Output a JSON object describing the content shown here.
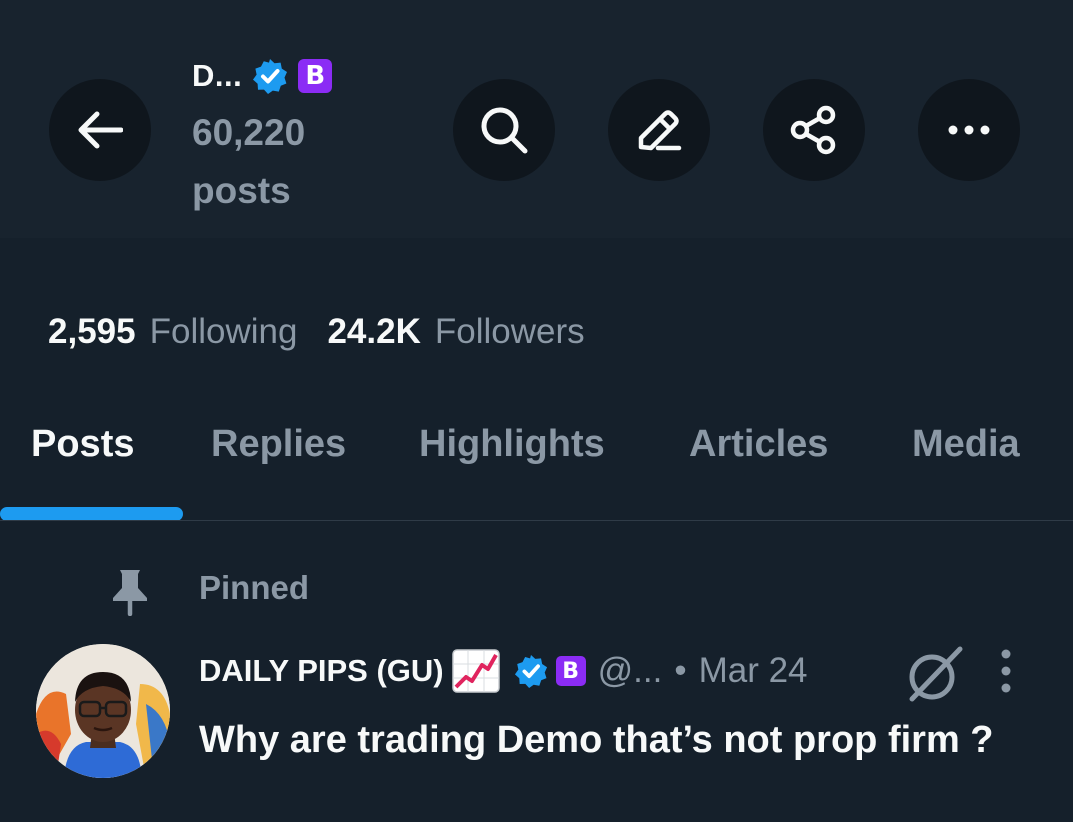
{
  "header": {
    "name": "D...",
    "badge_letter": "B",
    "post_count": "60,220 posts"
  },
  "stats": {
    "following_count": "2,595",
    "following_label": "Following",
    "followers_count": "24.2K",
    "followers_label": "Followers"
  },
  "tabs": [
    {
      "label": "Posts",
      "active": true
    },
    {
      "label": "Replies",
      "active": false
    },
    {
      "label": "Highlights",
      "active": false
    },
    {
      "label": "Articles",
      "active": false
    },
    {
      "label": "Media",
      "active": false
    }
  ],
  "pinned": {
    "label": "Pinned"
  },
  "post": {
    "author_name": "DAILY PIPS (GU)",
    "author_emoji": "📈",
    "badge_letter": "B",
    "handle": "@...",
    "separator": "•",
    "date": "Mar 24",
    "text": "Why are trading Demo that’s not prop firm ?"
  },
  "colors": {
    "background": "#15202b",
    "accent": "#1d9bf0",
    "muted": "#8b98a5",
    "badge_purple": "#8b2cf5"
  },
  "icons": {
    "back": "arrow-left-icon",
    "search": "search-icon",
    "edit": "edit-icon",
    "share": "share-icon",
    "more": "more-horizontal-icon",
    "pin": "pin-icon",
    "grok": "grok-icon",
    "kebab": "more-vertical-icon",
    "verified": "verified-badge-icon"
  }
}
